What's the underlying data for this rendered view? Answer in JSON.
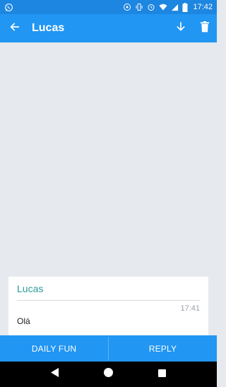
{
  "status_bar": {
    "time": "17:42",
    "icons": [
      "whatsapp-icon",
      "sync-icon",
      "vibrate-icon",
      "alarm-icon",
      "wifi-icon",
      "signal-icon",
      "battery-icon"
    ]
  },
  "app_bar": {
    "title": "Lucas",
    "icons": [
      "back-arrow-icon",
      "download-icon",
      "trash-icon"
    ]
  },
  "message_card": {
    "sender": "Lucas",
    "time": "17:41",
    "body": "Olá"
  },
  "bottom_bar": {
    "daily_fun_label": "DAILY FUN",
    "reply_label": "REPLY"
  },
  "nav_bar": {
    "icons": [
      "back-triangle-icon",
      "home-circle-icon",
      "recents-square-icon"
    ]
  },
  "colors": {
    "primary": "#2196f3",
    "status_bar": "#1d86e0",
    "sender_teal": "#2a9d9a",
    "background": "#e6e9ee"
  }
}
